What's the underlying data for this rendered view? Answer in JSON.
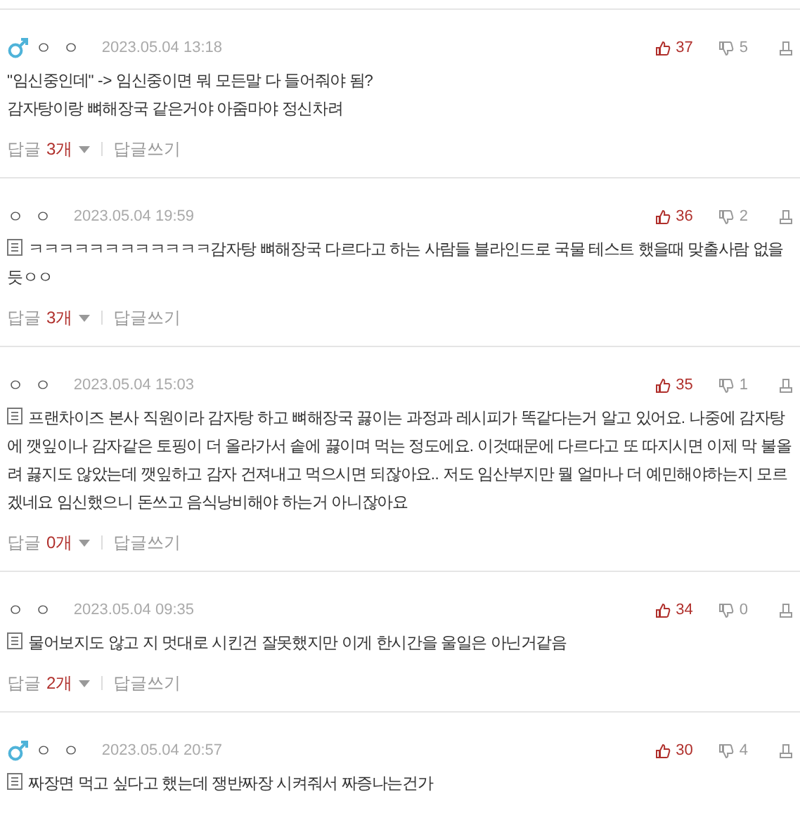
{
  "comments": [
    {
      "male": true,
      "author": "ㅇ ㅇ",
      "date": "2023.05.04 13:18",
      "likes": "37",
      "dislikes": "5",
      "memo": false,
      "body": "\"임신중인데\" -> 임신중이면 뭐 모든말 다 들어줘야 됨?\n감자탕이랑 뼈해장국 같은거야 아줌마야 정신차려",
      "reply_label": "답글",
      "reply_count": "3개",
      "write_reply": "답글쓰기"
    },
    {
      "male": false,
      "author": "ㅇ ㅇ",
      "date": "2023.05.04 19:59",
      "likes": "36",
      "dislikes": "2",
      "memo": true,
      "body": "ㅋㅋㅋㅋㅋㅋㅋㅋㅋㅋㅋㅋ감자탕 뼈해장국 다르다고 하는 사람들 블라인드로 국물 테스트 했을때 맞출사람 없을듯ㅇㅇ",
      "reply_label": "답글",
      "reply_count": "3개",
      "write_reply": "답글쓰기"
    },
    {
      "male": false,
      "author": "ㅇ ㅇ",
      "date": "2023.05.04 15:03",
      "likes": "35",
      "dislikes": "1",
      "memo": true,
      "body": "프랜차이즈 본사 직원이라 감자탕 하고 뼈해장국 끓이는 과정과 레시피가 똑같다는거 알고 있어요. 나중에 감자탕에 깻잎이나 감자같은 토핑이 더 올라가서 솥에 끓이며 먹는 정도에요. 이것때문에 다르다고 또 따지시면 이제 막 불올려 끓지도 않았는데 깻잎하고 감자 건져내고 먹으시면 되잖아요.. 저도 임산부지만 뭘 얼마나 더 예민해야하는지 모르겠네요 임신했으니 돈쓰고 음식낭비해야 하는거 아니잖아요",
      "reply_label": "답글",
      "reply_count": "0개",
      "write_reply": "답글쓰기"
    },
    {
      "male": false,
      "author": "ㅇ ㅇ",
      "date": "2023.05.04 09:35",
      "likes": "34",
      "dislikes": "0",
      "memo": true,
      "body": "물어보지도 않고 지 멋대로 시킨건 잘못했지만 이게 한시간을 울일은 아닌거같음",
      "reply_label": "답글",
      "reply_count": "2개",
      "write_reply": "답글쓰기"
    },
    {
      "male": true,
      "author": "ㅇ ㅇ",
      "date": "2023.05.04 20:57",
      "likes": "30",
      "dislikes": "4",
      "memo": true,
      "body": "짜장면 먹고 싶다고 했는데 쟁반짜장 시켜줘서 짜증나는건가"
    }
  ]
}
